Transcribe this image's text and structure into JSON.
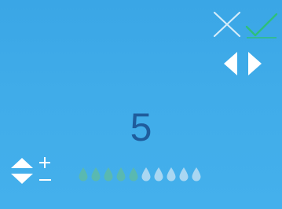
{
  "display": {
    "value": "5"
  },
  "icons": {
    "cancel": "close-icon",
    "confirm": "checkmark-icon",
    "navigation": "left-right-arrow-icons",
    "adjust": "up-down-plus-minus-icons",
    "level": "droplet-icons"
  },
  "level_indicator": {
    "filled": 5,
    "total": 10
  },
  "colors": {
    "background": "#40ace9",
    "value_text": "#1f5c9c",
    "confirm": "#2ec07a",
    "cancel": "#cfe9f8",
    "drop_filled": "#59b9b1",
    "drop_empty": "#a9d7f2"
  }
}
